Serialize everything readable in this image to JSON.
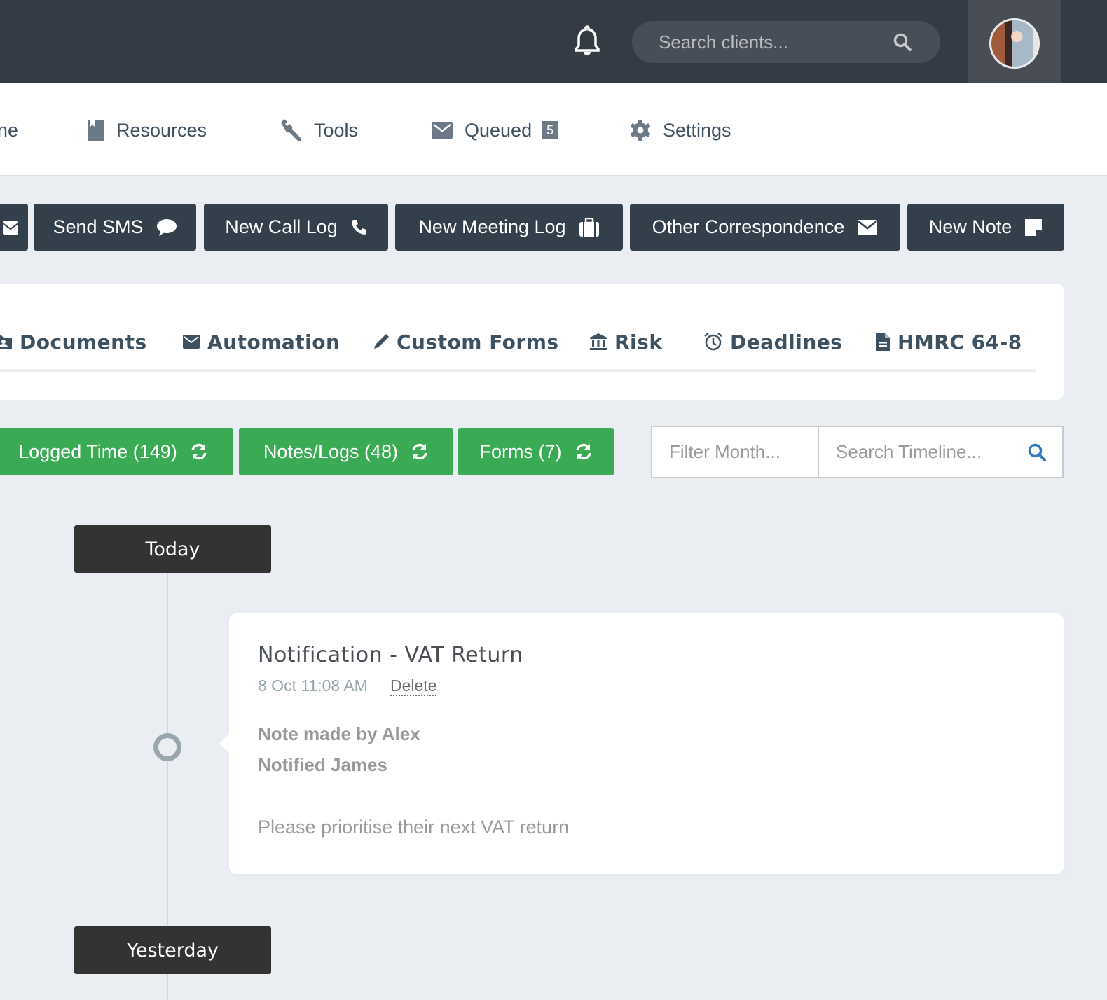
{
  "topbar": {
    "search_placeholder": "Search clients...",
    "icons": {
      "notifications": "bell-icon",
      "search": "search-icon",
      "avatar": "user-avatar"
    }
  },
  "nav": {
    "items": [
      {
        "label": "ne",
        "icon": "home-icon"
      },
      {
        "label": "Resources",
        "icon": "bookmark-book-icon"
      },
      {
        "label": "Tools",
        "icon": "wrench-icon"
      },
      {
        "label": "Queued",
        "icon": "envelope-icon",
        "badge": "5"
      },
      {
        "label": "Settings",
        "icon": "gear-icon"
      }
    ]
  },
  "actions": [
    {
      "label": "",
      "icon": "envelope-icon"
    },
    {
      "label": "Send SMS",
      "icon": "comment-icon"
    },
    {
      "label": "New Call Log",
      "icon": "phone-icon"
    },
    {
      "label": "New Meeting Log",
      "icon": "briefcase-icon"
    },
    {
      "label": "Other Correspondence",
      "icon": "envelope-icon"
    },
    {
      "label": "New Note",
      "icon": "sticky-note-icon"
    }
  ],
  "tabs": [
    {
      "label": "Documents",
      "icon": "folder-user-icon"
    },
    {
      "label": "Automation",
      "icon": "envelope-icon"
    },
    {
      "label": "Custom Forms",
      "icon": "pencil-icon"
    },
    {
      "label": "Risk",
      "icon": "bank-icon"
    },
    {
      "label": "Deadlines",
      "icon": "alarm-clock-icon"
    },
    {
      "label": "HMRC 64-8",
      "icon": "file-icon"
    }
  ],
  "filters": [
    {
      "label": "Logged Time (149)",
      "icon": "refresh-icon"
    },
    {
      "label": "Notes/Logs (48)",
      "icon": "refresh-icon"
    },
    {
      "label": "Forms (7)",
      "icon": "refresh-icon"
    }
  ],
  "filter_month_placeholder": "Filter Month...",
  "search_timeline_placeholder": "Search Timeline...",
  "colors": {
    "topbar": "#343b44",
    "action": "#343f4c",
    "filter_green": "#3aaa55",
    "accent_blue": "#2f7bc0"
  },
  "timeline": {
    "groups": [
      {
        "label": "Today",
        "entries": [
          {
            "title": "Notification - VAT Return",
            "time": "8 Oct 11:08 AM",
            "delete_label": "Delete",
            "meta": [
              "Note made by Alex",
              "Notified James"
            ],
            "body": "Please prioritise their next VAT return"
          }
        ]
      },
      {
        "label": "Yesterday",
        "entries": []
      }
    ]
  }
}
